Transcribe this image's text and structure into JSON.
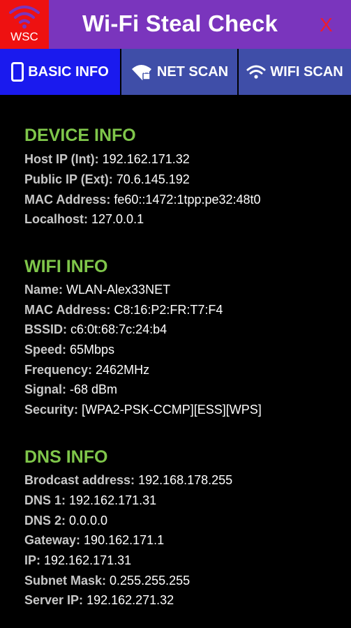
{
  "app": {
    "logo_text": "WSC",
    "title": "Wi-Fi Steal Check",
    "close_label": "X"
  },
  "tabs": [
    {
      "label": "BASIC INFO",
      "icon": "phone-icon",
      "active": true
    },
    {
      "label": "NET SCAN",
      "icon": "wifi-lock-icon",
      "active": false
    },
    {
      "label": "WIFI SCAN",
      "icon": "wifi-icon",
      "active": false
    }
  ],
  "device_info": {
    "title": "DEVICE INFO",
    "rows": [
      {
        "key": "Host IP (Int):",
        "value": "192.162.171.32"
      },
      {
        "key": "Public IP (Ext):",
        "value": "70.6.145.192"
      },
      {
        "key": "MAC Address:",
        "value": "fe60::1472:1tpp:pe32:48t0"
      },
      {
        "key": "Localhost:",
        "value": "127.0.0.1"
      }
    ]
  },
  "wifi_info": {
    "title": "WIFI INFO",
    "rows": [
      {
        "key": "Name:",
        "value": "WLAN-Alex33NET"
      },
      {
        "key": "MAC Address:",
        "value": "C8:16:P2:FR:T7:F4"
      },
      {
        "key": "BSSID:",
        "value": "c6:0t:68:7c:24:b4"
      },
      {
        "key": "Speed:",
        "value": "65Mbps"
      },
      {
        "key": "Frequency:",
        "value": "2462MHz"
      },
      {
        "key": "Signal:",
        "value": "-68 dBm"
      },
      {
        "key": "Security:",
        "value": "[WPA2-PSK-CCMP][ESS][WPS]"
      }
    ]
  },
  "dns_info": {
    "title": "DNS INFO",
    "rows": [
      {
        "key": "Brodcast address:",
        "value": "192.168.178.255"
      },
      {
        "key": "DNS 1:",
        "value": "192.162.171.31"
      },
      {
        "key": "DNS 2:",
        "value": "0.0.0.0"
      },
      {
        "key": "Gateway:",
        "value": "190.162.171.1"
      },
      {
        "key": "IP:",
        "value": "192.162.171.31"
      },
      {
        "key": "Subnet Mask:",
        "value": "0.255.255.255"
      },
      {
        "key": "Server IP:",
        "value": "192.162.271.32"
      }
    ]
  },
  "colors": {
    "header": "#7a35bd",
    "logo": "#ee1111",
    "tab_active": "#1a1aee",
    "tab_inactive": "#3f4ea8",
    "section_title": "#7fc64a",
    "close": "#ee1b2e"
  }
}
